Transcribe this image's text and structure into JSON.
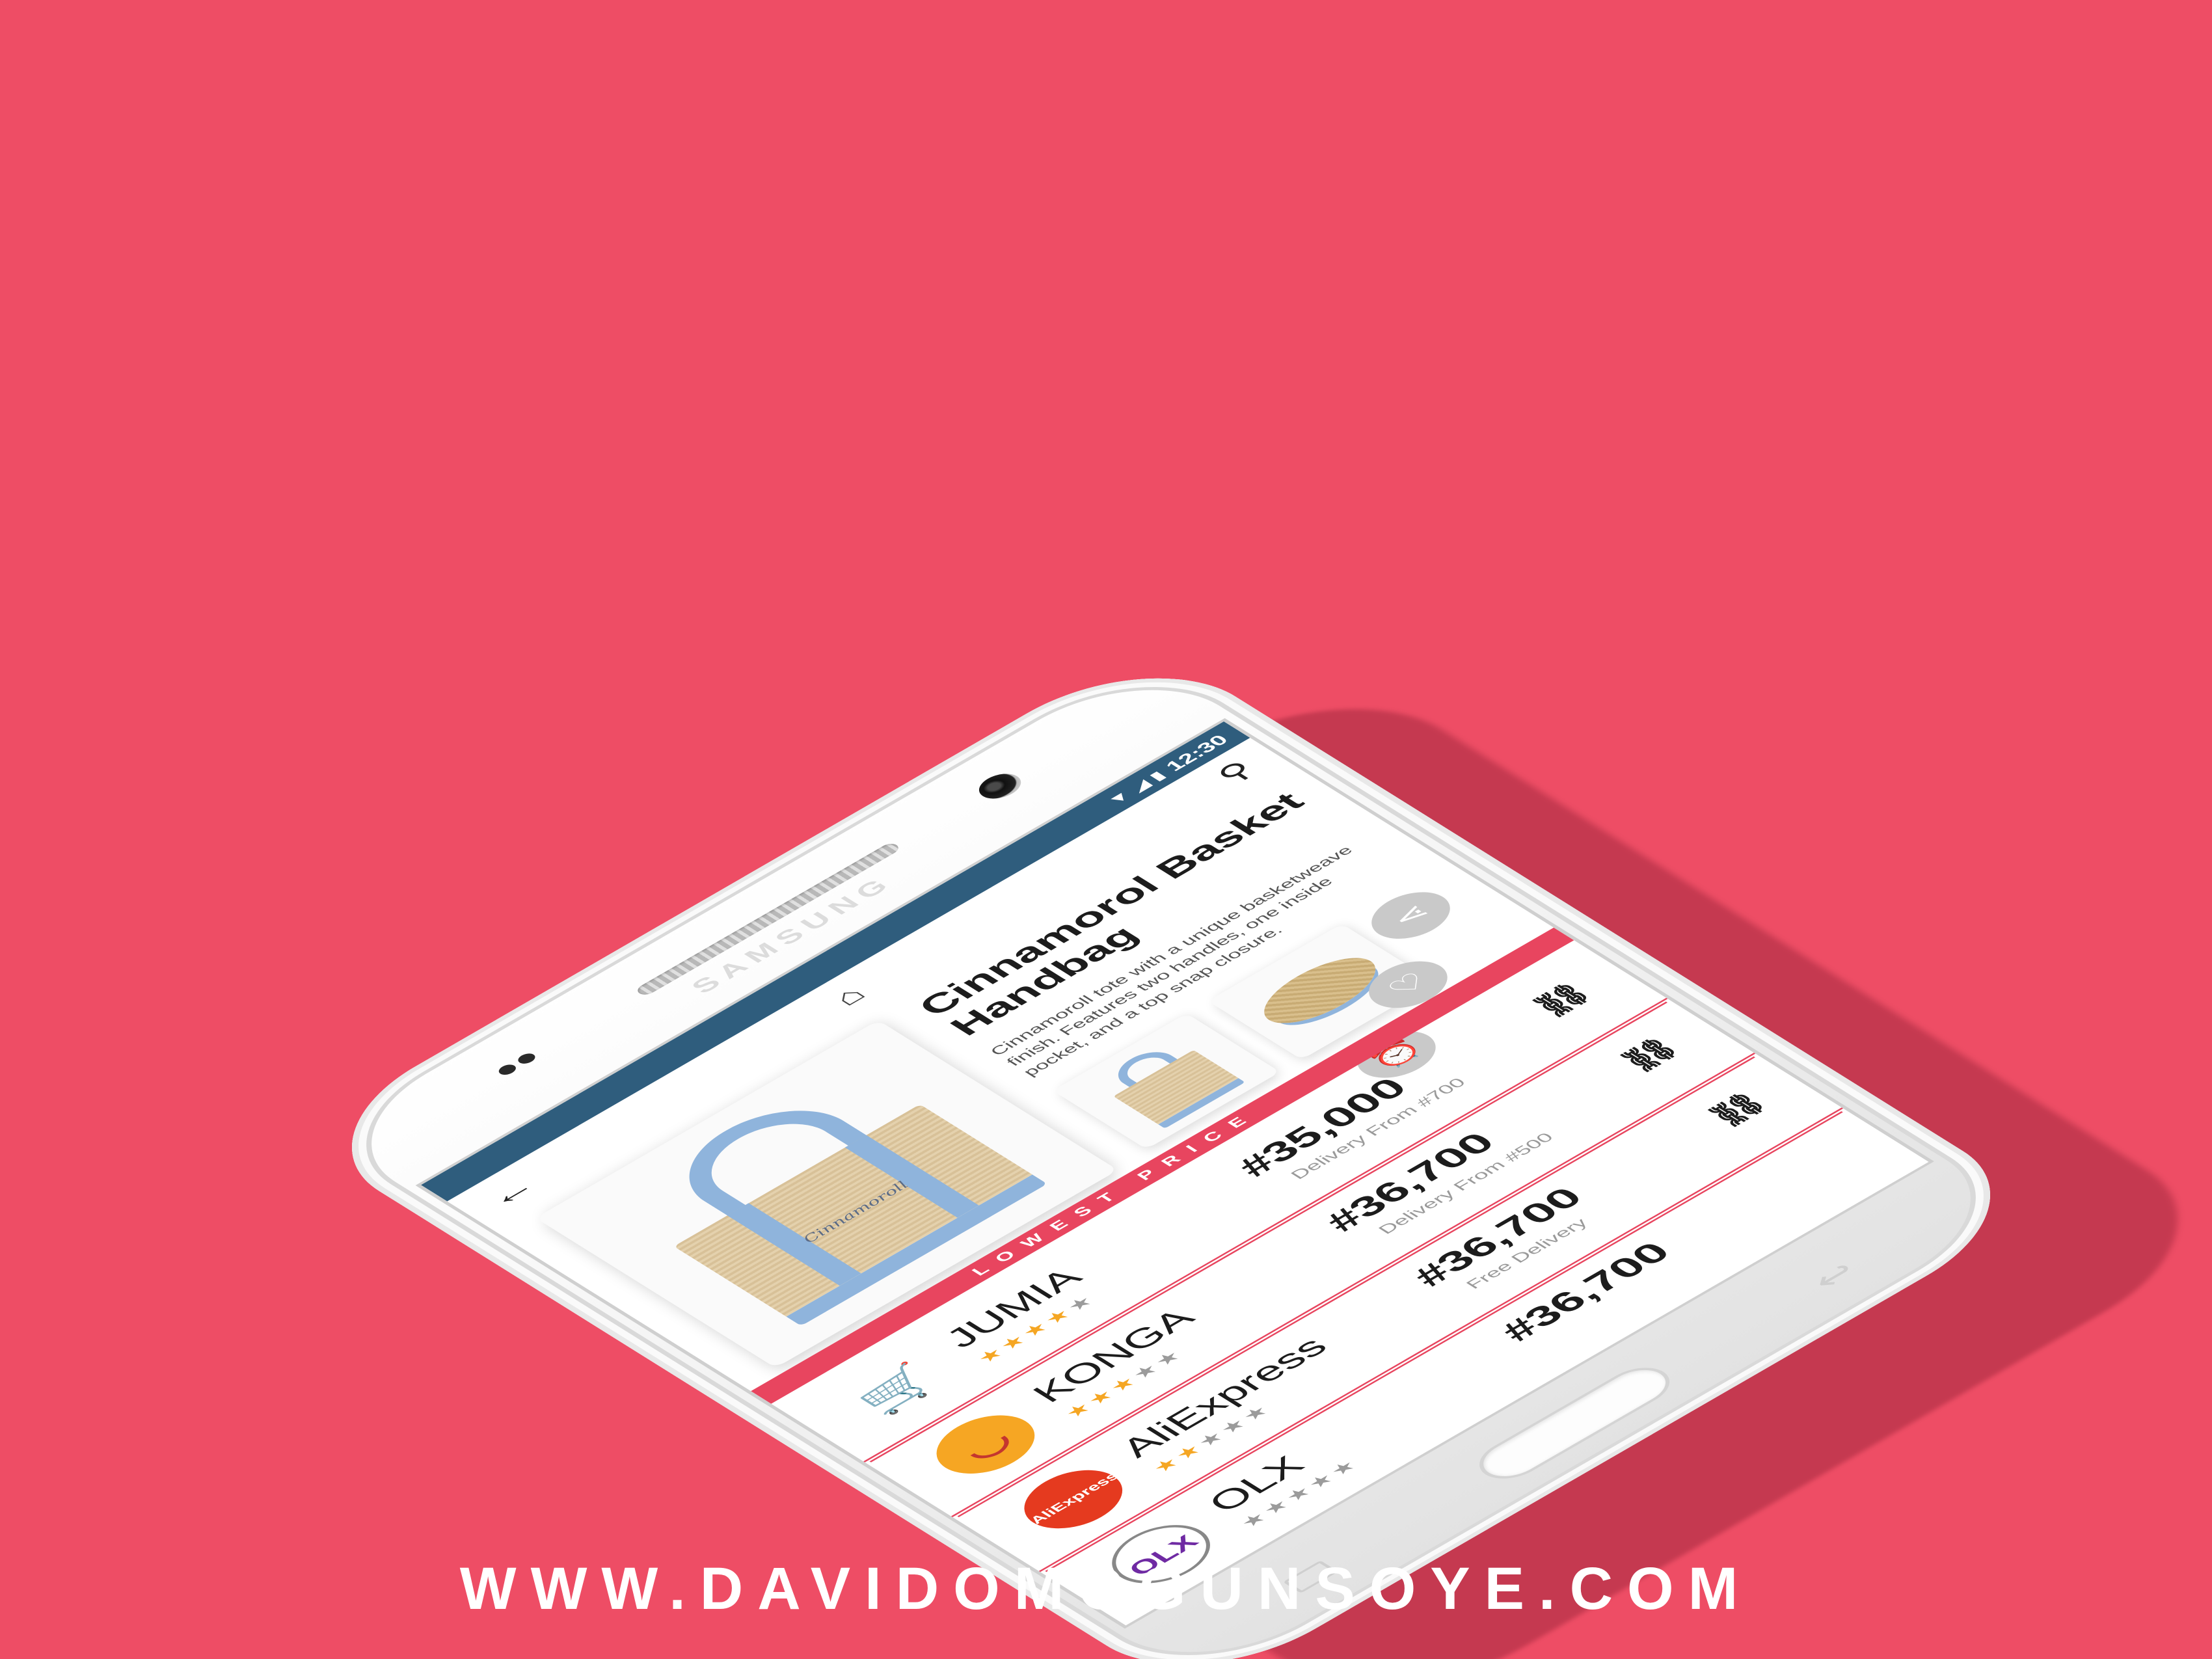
{
  "colors": {
    "background": "#ee4d65",
    "accent": "#e8455f",
    "statusbar": "#2f5d7d",
    "star_on": "#f5a623",
    "star_off": "#9b9b9b"
  },
  "device": {
    "brand": "SAMSUNG"
  },
  "statusbar": {
    "icons": "▼ ◢ ▮",
    "time": "12:30"
  },
  "appbar": {
    "back_icon": "back-arrow-icon",
    "home_icon": "home-icon",
    "search_icon": "search-icon"
  },
  "product": {
    "title": "Cinnamorol Basket Handbag",
    "description": "Cinnamoroll tote with a unique basketweave finish. Features two handles, one inside pocket, and a top snap closure.",
    "bag_logo": "Cinnamoroll"
  },
  "actions": {
    "share_icon": "share-icon",
    "like_icon": "heart-icon",
    "alarm_icon": "alarm-icon"
  },
  "lowest_price_label": "LOWEST PRICE",
  "stores": [
    {
      "name": "JUMIA",
      "rating": 4,
      "price": "#35,000",
      "delivery": "Delivery From #700",
      "logo_icon": "shopping-cart-icon"
    },
    {
      "name": "KONGA",
      "rating": 3,
      "price": "#36,700",
      "delivery": "Delivery From #500",
      "logo_icon": "konga-logo-icon"
    },
    {
      "name": "AliExpress",
      "rating": 2,
      "price": "#36,700",
      "delivery": "Free Delivery",
      "logo_icon": "aliexpress-logo-icon",
      "logo_text": "AliExpress"
    },
    {
      "name": "OLX",
      "rating": 0,
      "price": "#36,700",
      "delivery": "",
      "logo_icon": "olx-logo-icon",
      "logo_text": "OLX"
    }
  ],
  "website": "WWW.DAVIDOMOGUNSOYE.COM"
}
